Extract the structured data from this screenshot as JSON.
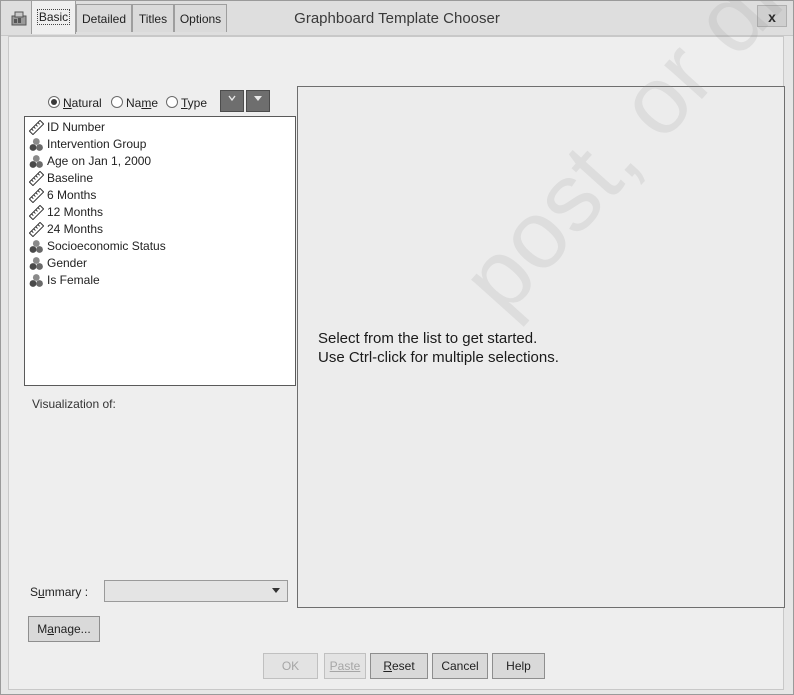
{
  "window": {
    "title": "Graphboard Template Chooser",
    "close_glyph": "x"
  },
  "tabs": [
    {
      "label": "Basic",
      "active": true
    },
    {
      "label": "Detailed",
      "active": false
    },
    {
      "label": "Titles",
      "active": false
    },
    {
      "label": "Options",
      "active": false
    }
  ],
  "sort": {
    "options": [
      {
        "label_pre": "",
        "label_u": "N",
        "label_post": "atural",
        "selected": true
      },
      {
        "label_pre": "Na",
        "label_u": "m",
        "label_post": "e",
        "selected": false
      },
      {
        "label_pre": "",
        "label_u": "T",
        "label_post": "ype",
        "selected": false
      }
    ]
  },
  "variables": [
    {
      "name": "ID Number",
      "icon": "ruler-icon"
    },
    {
      "name": "Intervention Group",
      "icon": "nominal-icon"
    },
    {
      "name": "Age on Jan 1, 2000",
      "icon": "nominal-icon"
    },
    {
      "name": "Baseline",
      "icon": "ruler-icon"
    },
    {
      "name": "6 Months",
      "icon": "ruler-icon"
    },
    {
      "name": "12 Months",
      "icon": "ruler-icon"
    },
    {
      "name": "24 Months",
      "icon": "ruler-icon"
    },
    {
      "name": "Socioeconomic Status",
      "icon": "nominal-icon"
    },
    {
      "name": "Gender",
      "icon": "nominal-icon"
    },
    {
      "name": "Is Female",
      "icon": "nominal-icon"
    }
  ],
  "visualization_label": "Visualization of:",
  "summary": {
    "label_pre": "S",
    "label_u": "u",
    "label_post": "mmary :",
    "value": ""
  },
  "manage": {
    "label_pre": "M",
    "label_u": "a",
    "label_post": "nage..."
  },
  "preview": {
    "line1": "Select from the list to get started.",
    "line2": "Use Ctrl-click for multiple selections."
  },
  "buttons": {
    "ok": "OK",
    "paste": "Paste",
    "reset_pre": "",
    "reset_u": "R",
    "reset_post": "eset",
    "cancel": "Cancel",
    "help": "Help"
  },
  "watermark": "post, or distribute"
}
